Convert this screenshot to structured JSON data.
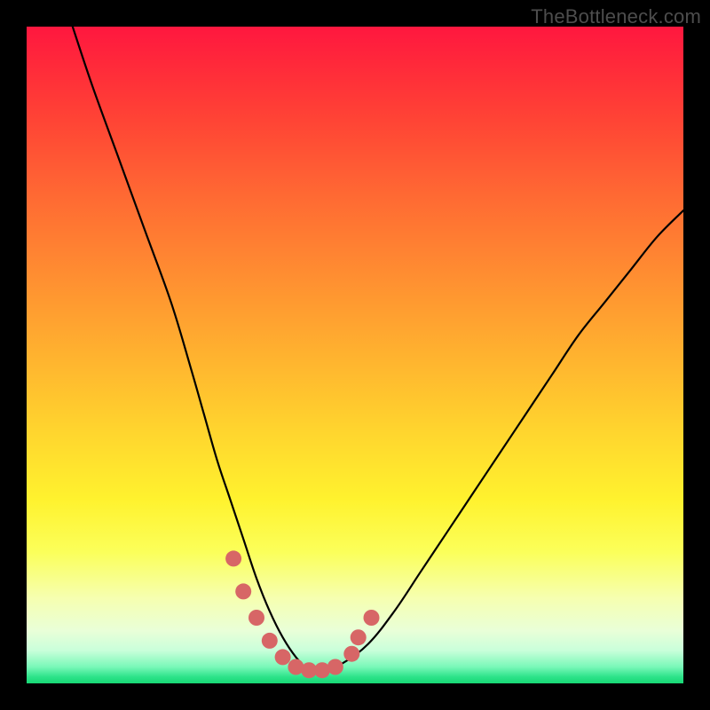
{
  "watermark": "TheBottleneck.com",
  "chart_data": {
    "type": "line",
    "title": "",
    "xlabel": "",
    "ylabel": "",
    "xlim": [
      0,
      100
    ],
    "ylim": [
      0,
      100
    ],
    "series": [
      {
        "name": "bottleneck-curve",
        "x": [
          7,
          10,
          14,
          18,
          22,
          25,
          27,
          29,
          31,
          33,
          35,
          37,
          39,
          41,
          43,
          45,
          48,
          52,
          56,
          60,
          64,
          68,
          72,
          76,
          80,
          84,
          88,
          92,
          96,
          100
        ],
        "values": [
          100,
          91,
          80,
          69,
          58,
          48,
          41,
          34,
          28,
          22,
          16,
          11,
          7,
          4,
          2,
          2,
          3,
          6,
          11,
          17,
          23,
          29,
          35,
          41,
          47,
          53,
          58,
          63,
          68,
          72
        ]
      }
    ],
    "markers": {
      "name": "highlight-points",
      "color": "#d76666",
      "x": [
        31.5,
        33.0,
        35.0,
        37.0,
        39.0,
        41.0,
        43.0,
        45.0,
        47.0,
        49.5,
        50.5,
        52.5
      ],
      "values": [
        19.0,
        14.0,
        10.0,
        6.5,
        4.0,
        2.5,
        2.0,
        2.0,
        2.5,
        4.5,
        7.0,
        10.0
      ]
    },
    "annotations": []
  }
}
